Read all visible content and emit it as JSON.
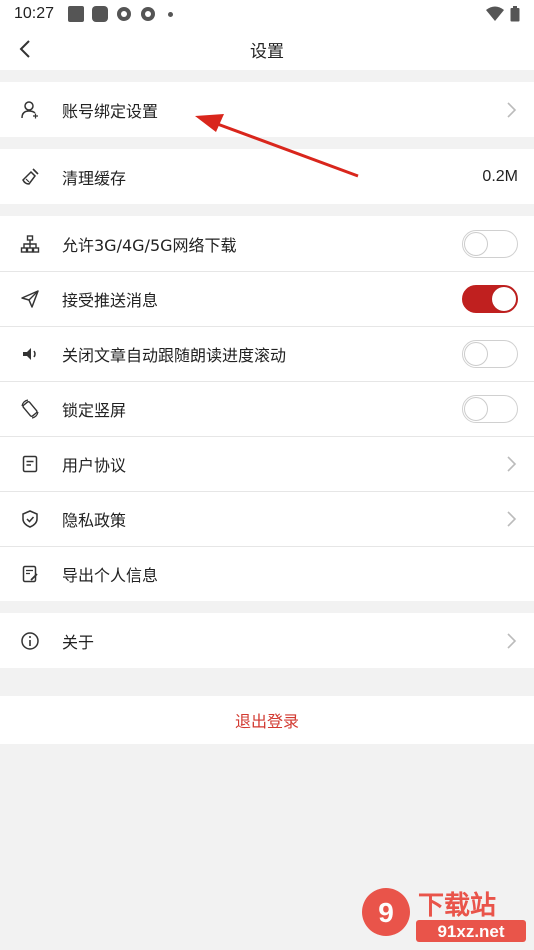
{
  "status_bar": {
    "time": "10:27"
  },
  "header": {
    "title": "设置"
  },
  "rows": {
    "account_binding": "账号绑定设置",
    "clear_cache": "清理缓存",
    "cache_size": "0.2M",
    "allow_download": "允许3G/4G/5G网络下载",
    "receive_push": "接受推送消息",
    "close_scroll": "关闭文章自动跟随朗读进度滚动",
    "lock_portrait": "锁定竖屏",
    "user_agreement": "用户协议",
    "privacy_policy": "隐私政策",
    "export_info": "导出个人信息",
    "about": "关于"
  },
  "toggles": {
    "allow_download": false,
    "receive_push": true,
    "close_scroll": false,
    "lock_portrait": false
  },
  "logout_label": "退出登录",
  "watermark": {
    "brand": "下载站",
    "domain": "91xz.net"
  },
  "colors": {
    "accent": "#c0201f",
    "logout_text": "#d23a31",
    "annotation_arrow": "#d9261c"
  },
  "icons": {
    "back": "chevron-left-icon",
    "account": "user-icon",
    "cache": "broom-icon",
    "network": "network-icon",
    "push": "send-icon",
    "speaker": "speaker-icon",
    "rotate": "rotate-icon",
    "agreement": "document-icon",
    "privacy": "shield-icon",
    "export": "export-document-icon",
    "about": "info-icon"
  }
}
